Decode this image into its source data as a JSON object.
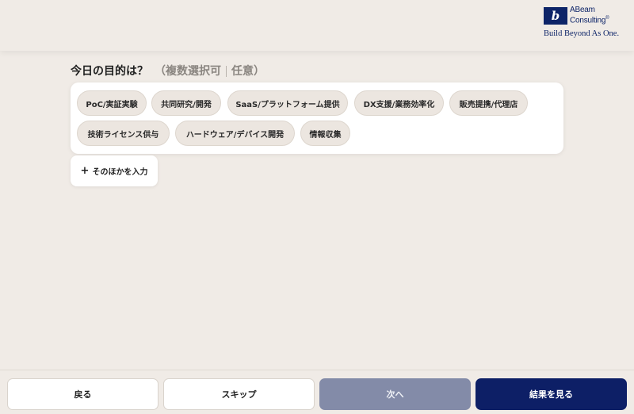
{
  "header": {
    "logo": {
      "mark": "b",
      "line1": "ABeam",
      "line2": "Consulting",
      "registered": "®",
      "tagline": "Build Beyond As One."
    }
  },
  "question": {
    "main": "今日の目的は？",
    "sub_open": "（複数選択可",
    "sub_close": "任意）"
  },
  "options": [
    "PoC/実証実験",
    "共同研究/開発",
    "SaaS/プラットフォーム提供",
    "DX支援/業務効率化",
    "販売提携/代理店",
    "技術ライセンス供与",
    "ハードウェア/デバイス開発",
    "情報収集"
  ],
  "add_other": {
    "plus": "+",
    "label": "そのほかを入力"
  },
  "footer": {
    "back": "戻る",
    "skip": "スキップ",
    "next": "次へ",
    "results": "結果を見る"
  },
  "colors": {
    "background": "#f0ebe6",
    "primary": "#0d1f66",
    "disabled": "#838ba8",
    "chip": "#ece6e0"
  }
}
